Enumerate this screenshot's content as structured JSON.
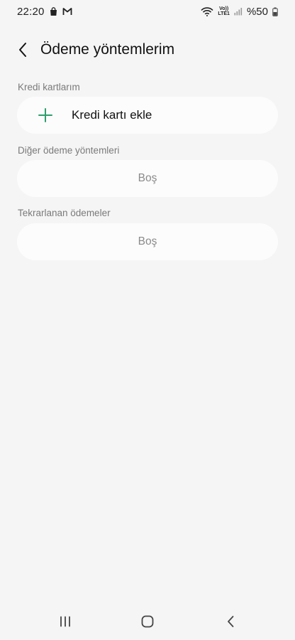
{
  "status_bar": {
    "time": "22:20",
    "network_label_top": "Vo))",
    "network_label_bottom": "LTE1",
    "battery": "%50"
  },
  "header": {
    "title": "Ödeme yöntemlerim"
  },
  "sections": {
    "credit_cards": {
      "label": "Kredi kartlarım",
      "add_label": "Kredi kartı ekle"
    },
    "other_methods": {
      "label": "Diğer ödeme yöntemleri",
      "empty_text": "Boş"
    },
    "recurring": {
      "label": "Tekrarlanan ödemeler",
      "empty_text": "Boş"
    }
  },
  "colors": {
    "background": "#f5f5f5",
    "card": "#fcfcfc",
    "accent_plus": "#2e9e6b",
    "muted_text": "#7a7a7a"
  },
  "icons": {
    "back": "chevron-left-icon",
    "plus": "plus-icon",
    "nav_recents": "recent-apps-icon",
    "nav_home": "home-icon",
    "nav_back": "back-icon"
  }
}
